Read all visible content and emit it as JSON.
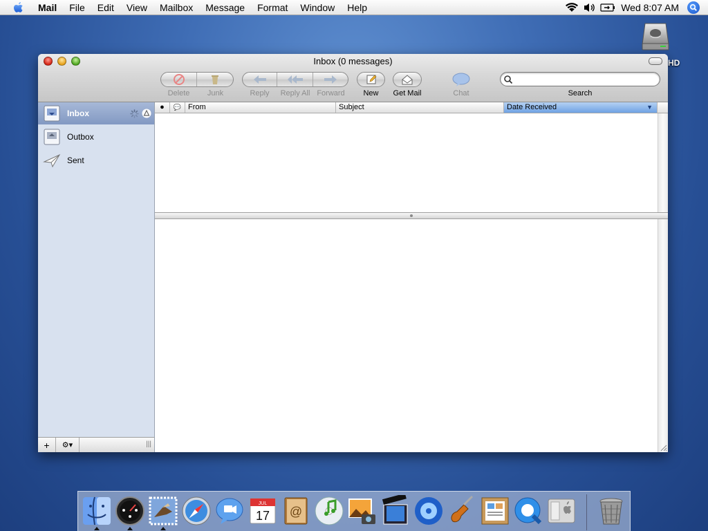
{
  "menubar": {
    "app_name": "Mail",
    "items": [
      "File",
      "Edit",
      "View",
      "Mailbox",
      "Message",
      "Format",
      "Window",
      "Help"
    ],
    "clock": "Wed 8:07 AM"
  },
  "desktop": {
    "hd_label": "HD"
  },
  "window": {
    "title": "Inbox (0 messages)",
    "toolbar": {
      "delete": "Delete",
      "junk": "Junk",
      "reply": "Reply",
      "reply_all": "Reply All",
      "forward": "Forward",
      "new": "New",
      "get_mail": "Get Mail",
      "chat": "Chat",
      "search": "Search"
    },
    "search": {
      "value": "",
      "placeholder": ""
    },
    "sidebar": {
      "mailboxes": [
        {
          "label": "Inbox",
          "icon": "inbox-icon",
          "selected": true
        },
        {
          "label": "Outbox",
          "icon": "outbox-icon",
          "selected": false
        },
        {
          "label": "Sent",
          "icon": "sent-icon",
          "selected": false
        }
      ],
      "add_button": "+",
      "action_button": "⚙▾",
      "resize_handle": "|||"
    },
    "columns": {
      "unread": "●",
      "attachment": "💬",
      "from": "From",
      "subject": "Subject",
      "date_received": "Date Received",
      "sort_indicator": "▼"
    },
    "messages": []
  },
  "dock": {
    "apps": [
      "finder-icon",
      "dashboard-icon",
      "mail-icon",
      "safari-icon",
      "ichat-icon",
      "ical-icon",
      "address-book-icon",
      "itunes-icon",
      "iphoto-icon",
      "imovie-icon",
      "idvd-icon",
      "garageband-icon",
      "preview-icon",
      "quicktime-icon",
      "system-preferences-icon",
      "trash-icon"
    ],
    "ical_date": "17",
    "ical_month": "JUL"
  },
  "colors": {
    "desktop": "#3f6db5",
    "selection": "#8299c2",
    "sidebar": "#d8e1ef",
    "sorted_column": "#6fa2e3"
  }
}
